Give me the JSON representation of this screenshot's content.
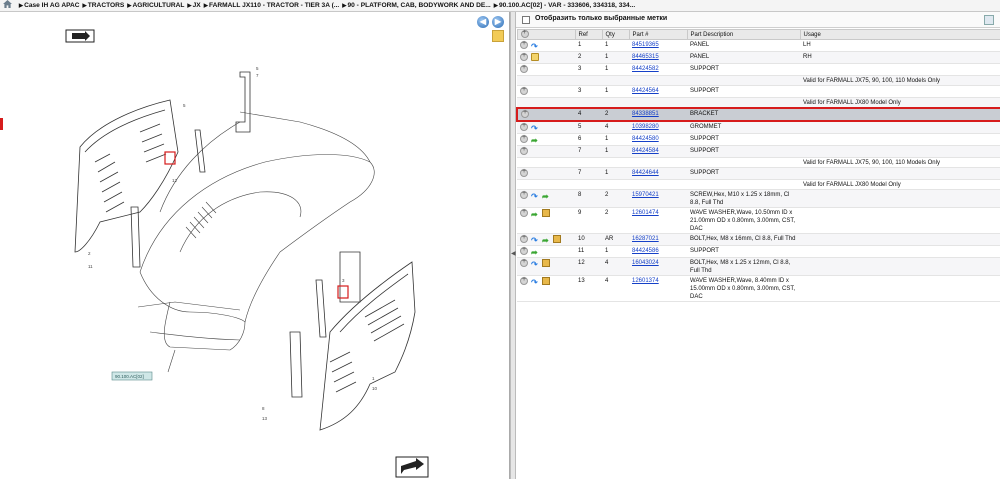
{
  "breadcrumb": {
    "items": [
      "Case IH AG APAC",
      "TRACTORS",
      "AGRICULTURAL",
      "JX",
      "FARMALL JX110 - TRACTOR - TIER 3A (...",
      "90 - PLATFORM, CAB, BODYWORK AND DE...",
      "90.100.AC[02] - VAR - 333606, 334318, 334..."
    ]
  },
  "diagram": {
    "ref_label": "90.100.AC[02]",
    "callouts": [
      "1",
      "2",
      "3",
      "4",
      "5",
      "6",
      "7",
      "8",
      "9",
      "10",
      "11",
      "12",
      "13"
    ]
  },
  "filter": {
    "label": "Отобразить только выбранные метки"
  },
  "table": {
    "headers": [
      "",
      "Ref",
      "Qty",
      "Part #",
      "Part Description",
      "Usage"
    ],
    "rows": [
      {
        "ref": "1",
        "qty": "1",
        "part": "84519365",
        "desc": "PANEL",
        "usage": "LH",
        "icons": [
          "plus",
          "arrow"
        ]
      },
      {
        "ref": "2",
        "qty": "1",
        "part": "84465315",
        "desc": "PANEL",
        "usage": "RH",
        "icons": [
          "plus",
          "folder"
        ]
      },
      {
        "ref": "3",
        "qty": "1",
        "part": "84424582",
        "desc": "SUPPORT",
        "usage": "",
        "icons": [
          "plus"
        ]
      },
      {
        "ref": "",
        "qty": "",
        "part": "",
        "desc": "",
        "usage": "Valid for FARMALL JX75, 90, 100, 110 Models Only",
        "icons": []
      },
      {
        "ref": "3",
        "qty": "1",
        "part": "84424564",
        "desc": "SUPPORT",
        "usage": "",
        "icons": [
          "plus"
        ]
      },
      {
        "ref": "",
        "qty": "",
        "part": "",
        "desc": "",
        "usage": "Valid for FARMALL JX80 Model Only",
        "icons": []
      },
      {
        "ref": "4",
        "qty": "2",
        "part": "84338851",
        "desc": "BRACKET",
        "usage": "",
        "icons": [
          "plus"
        ],
        "selected": true
      },
      {
        "ref": "5",
        "qty": "4",
        "part": "10398280",
        "desc": "GROMMET",
        "usage": "",
        "icons": [
          "plus",
          "arrow"
        ]
      },
      {
        "ref": "6",
        "qty": "1",
        "part": "84424580",
        "desc": "SUPPORT",
        "usage": "",
        "icons": [
          "plus",
          "garrow"
        ]
      },
      {
        "ref": "7",
        "qty": "1",
        "part": "84424584",
        "desc": "SUPPORT",
        "usage": "",
        "icons": [
          "plus"
        ]
      },
      {
        "ref": "",
        "qty": "",
        "part": "",
        "desc": "",
        "usage": "Valid for FARMALL JX75, 90, 100, 110 Models Only",
        "icons": []
      },
      {
        "ref": "7",
        "qty": "1",
        "part": "84424644",
        "desc": "SUPPORT",
        "usage": "",
        "icons": [
          "plus"
        ]
      },
      {
        "ref": "",
        "qty": "",
        "part": "",
        "desc": "",
        "usage": "Valid for FARMALL JX80 Model Only",
        "icons": []
      },
      {
        "ref": "8",
        "qty": "2",
        "part": "15970421",
        "desc": "SCREW,Hex, M10 x 1.25 x 18mm, Cl 8.8, Full Thd",
        "usage": "",
        "icons": [
          "plus",
          "arrow",
          "garrow"
        ]
      },
      {
        "ref": "9",
        "qty": "2",
        "part": "12601474",
        "desc": "WAVE WASHER,Wave, 10.50mm ID x 21.00mm OD x 0.80mm, 3.00mm, CST, DAC",
        "usage": "",
        "icons": [
          "plus",
          "garrow",
          "box"
        ]
      },
      {
        "ref": "10",
        "qty": "AR",
        "part": "16287021",
        "desc": "BOLT,Hex, M8 x 16mm, Cl 8.8, Full Thd",
        "usage": "",
        "icons": [
          "plus",
          "arrow",
          "garrow",
          "box"
        ]
      },
      {
        "ref": "11",
        "qty": "1",
        "part": "84424586",
        "desc": "SUPPORT",
        "usage": "",
        "icons": [
          "plus",
          "garrow"
        ]
      },
      {
        "ref": "12",
        "qty": "4",
        "part": "16043024",
        "desc": "BOLT,Hex, M8 x 1.25 x 12mm, Cl 8.8, Full Thd",
        "usage": "",
        "icons": [
          "plus",
          "arrow",
          "box"
        ]
      },
      {
        "ref": "13",
        "qty": "4",
        "part": "12601374",
        "desc": "WAVE WASHER,Wave, 8.40mm ID x 15.00mm OD x 0.80mm, 3.00mm, CST, DAC",
        "usage": "",
        "icons": [
          "plus",
          "arrow",
          "box"
        ]
      }
    ]
  }
}
